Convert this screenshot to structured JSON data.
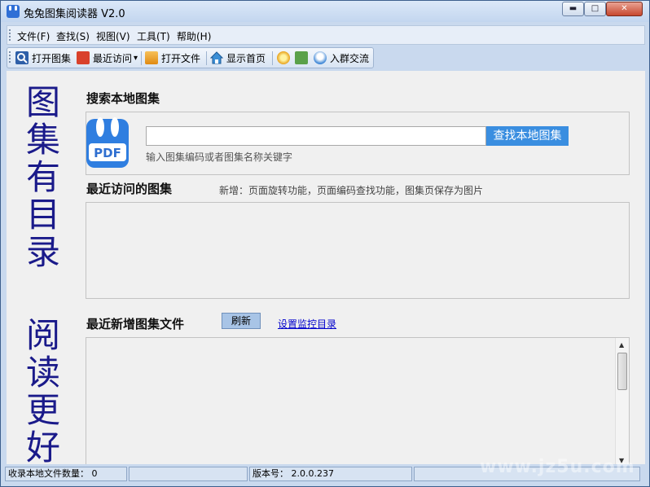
{
  "window": {
    "title": "兔兔图集阅读器 V2.0",
    "controls": {
      "minimize": "▬",
      "maximize": "□",
      "close": "✕"
    }
  },
  "menu": [
    {
      "label": "文件(F)"
    },
    {
      "label": "查找(S)"
    },
    {
      "label": "视图(V)"
    },
    {
      "label": "工具(T)"
    },
    {
      "label": "帮助(H)"
    }
  ],
  "toolbar": {
    "open_atlas": "打开图集",
    "recent": "最近访问",
    "recent_arrow": "▾",
    "open_file": "打开文件",
    "show_home": "显示首页",
    "join_group": "入群交流"
  },
  "sidebar_text": {
    "top": [
      "图",
      "集",
      "有",
      "目",
      "录"
    ],
    "bottom": [
      "阅",
      "读",
      "更",
      "好"
    ]
  },
  "search": {
    "title": "搜索本地图集",
    "logo_text": "PDF",
    "input_value": "",
    "button": "查找本地图集",
    "hint": "输入图集编码或者图集名称关键字"
  },
  "recent": {
    "title": "最近访问的图集",
    "news": "新增：页面旋转功能，页面编码查找功能，图集页保存为图片"
  },
  "new_files": {
    "title": "最近新增图集文件",
    "refresh": "刷新",
    "set_monitor": "设置监控目录"
  },
  "status": {
    "count": "收录本地文件数量： 0",
    "version": "版本号： 2.0.0.237"
  },
  "watermark": "www.jz5u.com",
  "colors": {
    "accent": "#3a8ee0",
    "title_text": "#1a1a8a",
    "link": "#0000cc"
  }
}
